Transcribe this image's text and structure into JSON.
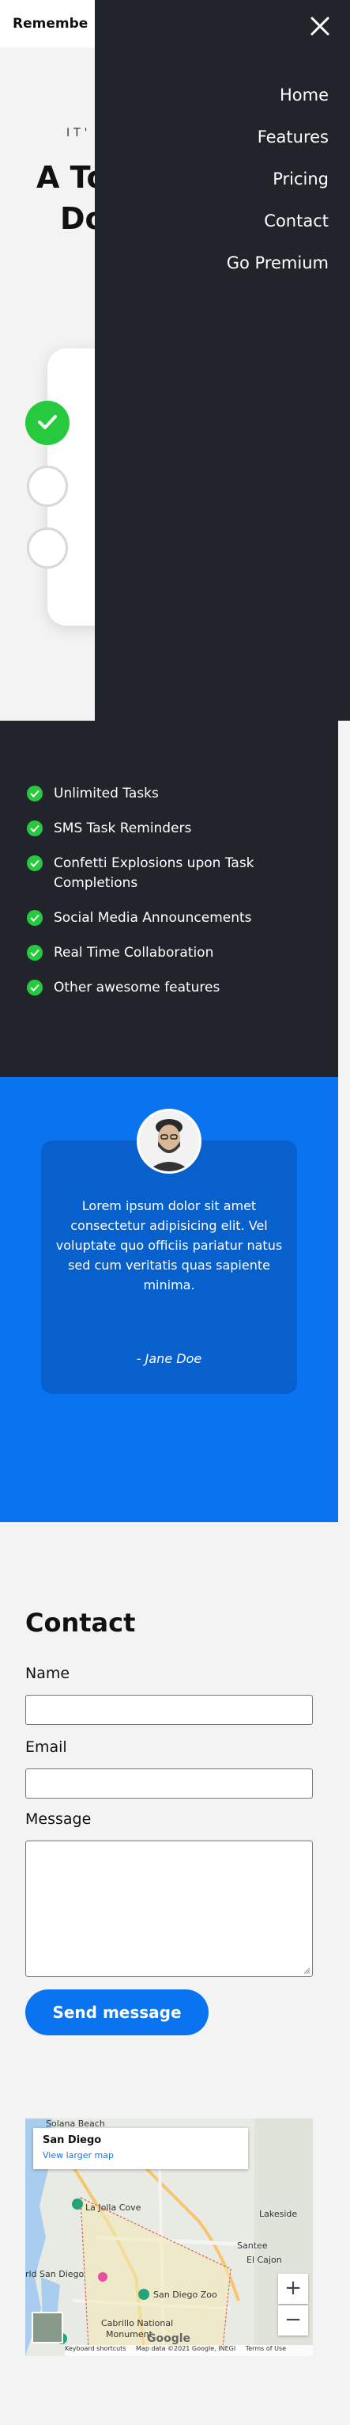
{
  "brand": {
    "name": "Remembe"
  },
  "hero": {
    "eyebrow": "IT'",
    "title_line1": "A To",
    "title_line2": "Do"
  },
  "nav": {
    "items": [
      "Home",
      "Features",
      "Pricing",
      "Contact",
      "Go Premium"
    ]
  },
  "features": {
    "items": [
      "Unlimited Tasks",
      "SMS Task Reminders",
      "Confetti Explosions upon Task Completions",
      "Social Media Announcements",
      "Real Time Collaboration",
      "Other awesome features"
    ]
  },
  "testimonial": {
    "quote": "Lorem ipsum dolor sit amet consectetur adipisicing elit. Vel voluptate quo officiis pariatur natus sed cum veritatis quas sapiente minima.",
    "author": "- Jane Doe"
  },
  "contact": {
    "title": "Contact",
    "name_label": "Name",
    "email_label": "Email",
    "message_label": "Message",
    "name_value": "",
    "email_value": "",
    "message_value": "",
    "submit_label": "Send message"
  },
  "map": {
    "place_name": "San Diego",
    "larger_map_link": "View larger map",
    "labels": {
      "solana_beach": "Solana Beach",
      "la_jolla_cove": "La Jolla Cove",
      "san_diego": "rld San Diego",
      "lakeside": "Lakeside",
      "santee": "Santee",
      "el_cajon": "El Cajon",
      "san_diego_zoo": "San Diego Zoo",
      "cabrillo": "Cabrillo National",
      "monument": "Monument"
    },
    "zoom_in": "+",
    "zoom_out": "−",
    "google": "Google",
    "footer": {
      "shortcuts": "Keyboard shortcuts",
      "attribution": "Map data ©2021 Google, INEGI",
      "terms": "Terms of Use"
    }
  },
  "colors": {
    "dark": "#21252b",
    "accent_blue": "#0a74f0",
    "check_green": "#27c93f"
  }
}
